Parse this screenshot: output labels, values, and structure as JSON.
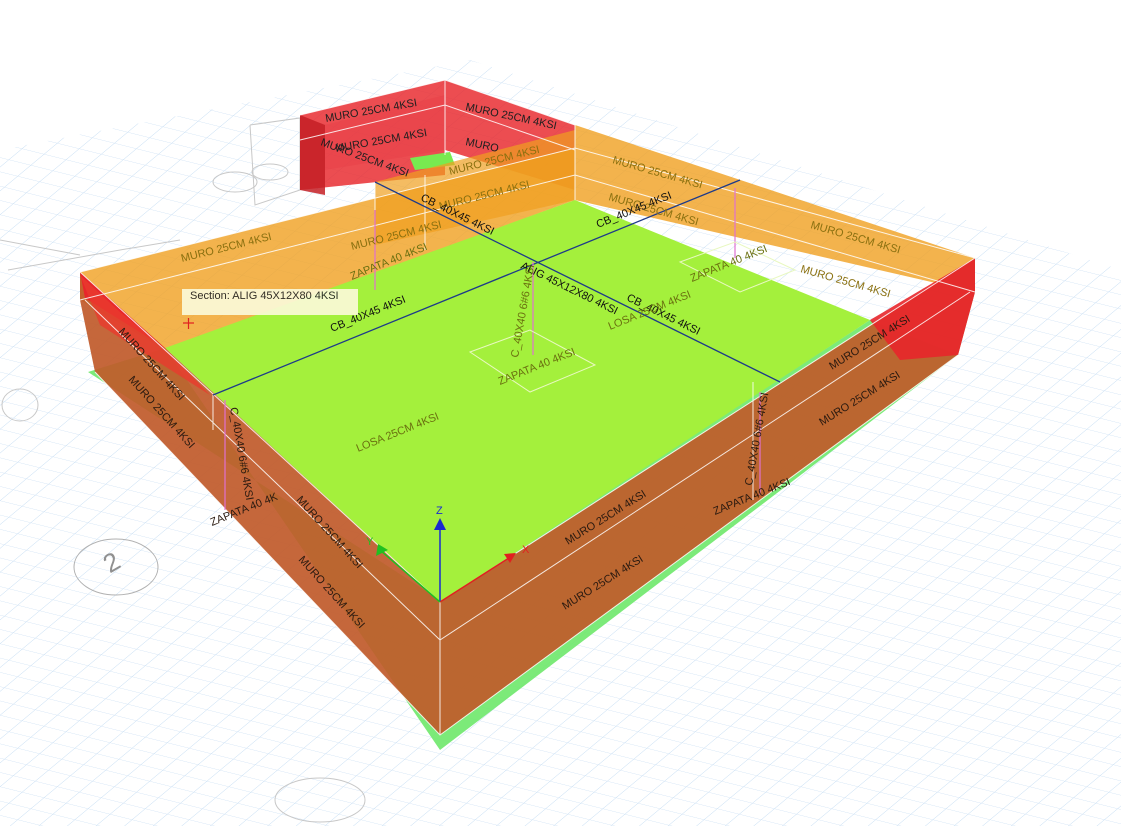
{
  "tooltip": {
    "text": "Section: ALIG 45X12X80 4KSI"
  },
  "grid_bubble": {
    "label": "2"
  },
  "axes": {
    "x": "X",
    "y": "Y",
    "z": "Z"
  },
  "labels": {
    "muro": "MURO 25CM 4KSI",
    "muro_short": "MURO",
    "losa": "LOSA 25CM 4KSI",
    "cb": "CB_40X45 4KSI",
    "alig": "ALIG 45X12X80 4KSI",
    "columna": "C_40X40 6#6 4KSI",
    "zapata": "ZAPATA 40 4KSI",
    "zapata_cut": "ZAPATA 40 4K"
  },
  "colors": {
    "wall_red": "#e8262b",
    "wall_orange": "#f0a020",
    "wall_brown": "#c05a2a",
    "slab": "#a4f03c",
    "footing": "#6ee86a",
    "beam": "#1d3a8a",
    "column": "#e070d0",
    "grid": "#b8d4f0"
  }
}
